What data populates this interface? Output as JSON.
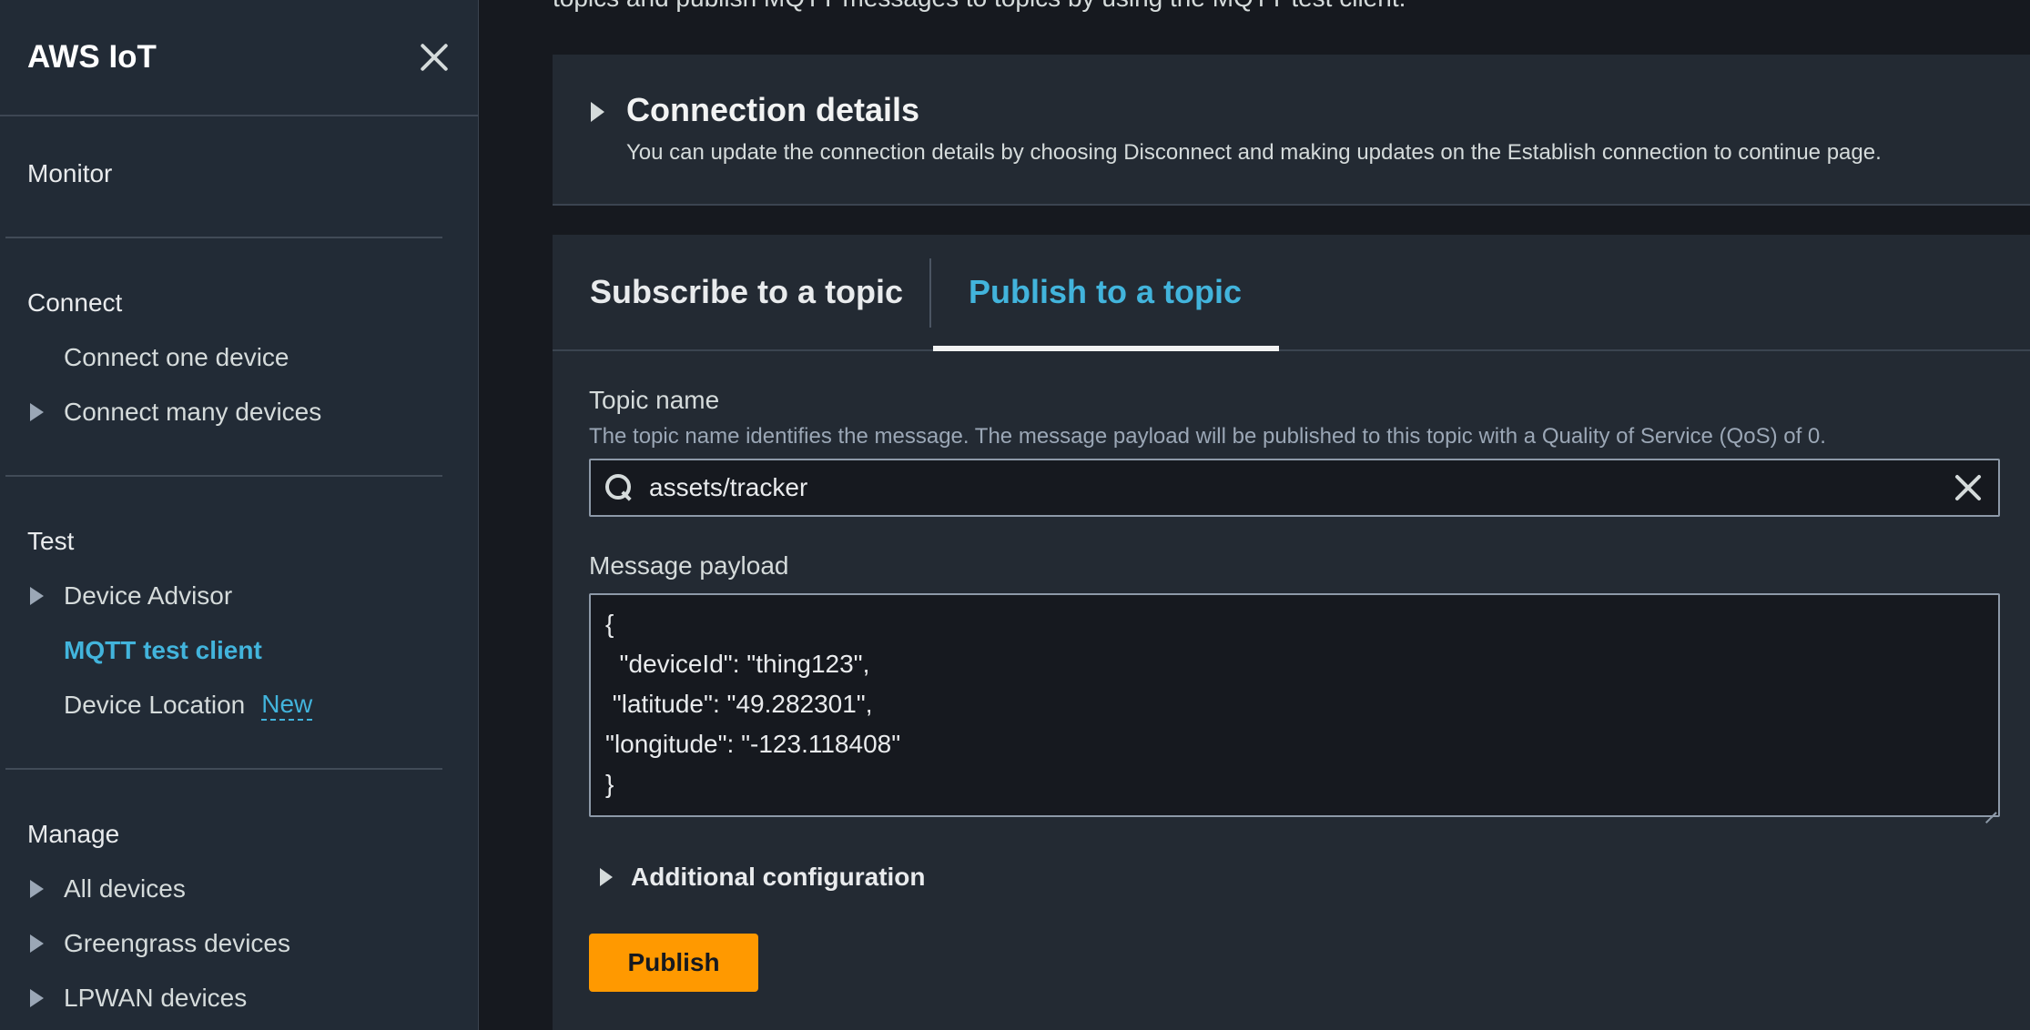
{
  "sidebar": {
    "title": "AWS IoT",
    "sections": {
      "monitor": {
        "label": "Monitor"
      },
      "connect": {
        "label": "Connect",
        "items": [
          "Connect one device",
          "Connect many devices"
        ]
      },
      "test": {
        "label": "Test",
        "items": [
          "Device Advisor",
          "MQTT test client",
          "Device Location"
        ],
        "new_badge": "New"
      },
      "manage": {
        "label": "Manage",
        "items": [
          "All devices",
          "Greengrass devices",
          "LPWAN devices"
        ]
      }
    }
  },
  "main": {
    "top_clipped_text": "topics and publish MQTT messages to topics by using the MQTT test client.",
    "connection_details": {
      "title": "Connection details",
      "description": "You can update the connection details by choosing Disconnect and making updates on the Establish connection to continue page."
    },
    "tabs": [
      {
        "label": "Subscribe to a topic",
        "active": false
      },
      {
        "label": "Publish to a topic",
        "active": true
      }
    ],
    "topic": {
      "label": "Topic name",
      "hint": "The topic name identifies the message. The message payload will be published to this topic with a Quality of Service (QoS) of 0.",
      "value": "assets/tracker"
    },
    "payload": {
      "label": "Message payload",
      "value": "{\n  \"deviceId\": \"thing123\",\n \"latitude\": \"49.282301\",\n\"longitude\": \"-123.118408\"\n}"
    },
    "additional_configuration": "Additional configuration",
    "publish_label": "Publish"
  },
  "colors": {
    "accent": "#42b4dc",
    "primary_button": "#ff9900",
    "background": "#16191f",
    "panel": "#232a33"
  }
}
